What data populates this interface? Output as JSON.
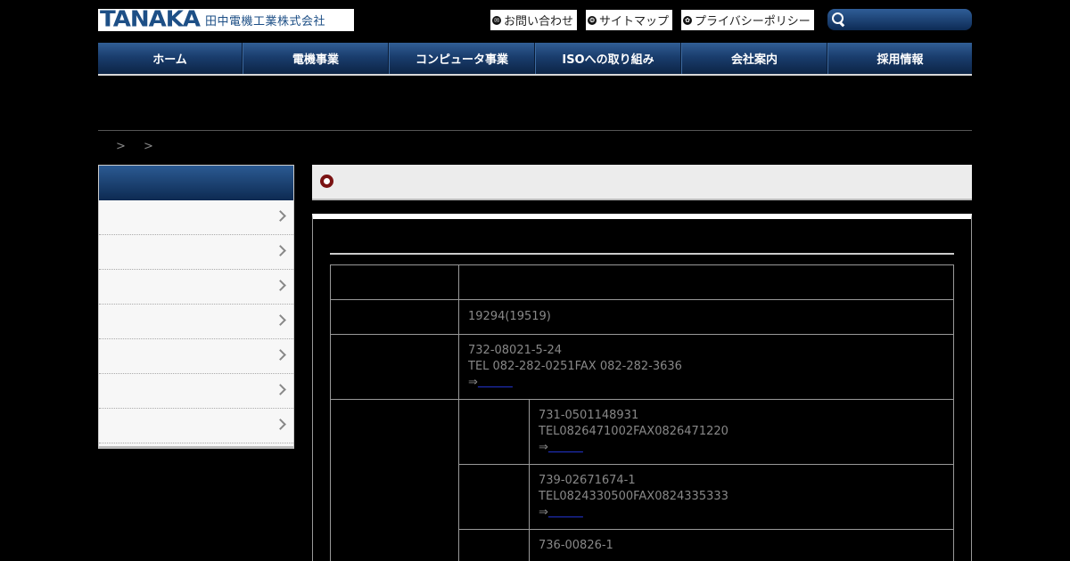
{
  "header": {
    "logo_brand": "TANAKA",
    "logo_company": "田中電機工業株式会社",
    "links": [
      {
        "icon": "mail-icon",
        "label": "お問い合わせ"
      },
      {
        "icon": "sitemap-icon",
        "label": "サイトマップ"
      },
      {
        "icon": "privacy-icon",
        "label": "プライバシーポリシー"
      }
    ],
    "search_placeholder": ""
  },
  "nav": [
    "ホーム",
    "電機事業",
    "コンピュータ事業",
    "ISOへの取り組み",
    "会社案内",
    "採用情報"
  ],
  "breadcrumb": [
    ">",
    ">"
  ],
  "sidebar": {
    "items": 7
  },
  "table": {
    "row2_value": "19294(19519)",
    "row3_addr": "732-08021-5-24",
    "row3_tel": "TEL 082-282-0251FAX 082-282-3636",
    "row3_arrow": "⇒",
    "row3_link": "　　　",
    "branches": [
      {
        "addr": "731-0501148931",
        "tel": "TEL0826471002FAX0826471220",
        "arrow": "⇒",
        "link": "　　　"
      },
      {
        "addr": "739-02671674-1",
        "tel": "TEL0824330500FAX0824335333",
        "arrow": "⇒",
        "link": "　　　"
      },
      {
        "addr": "736-00826-1"
      }
    ]
  },
  "colors": {
    "nav_top": "#315e95",
    "nav_bottom": "#0c2446",
    "bullet": "#7a1212",
    "link": "#2233cc"
  }
}
